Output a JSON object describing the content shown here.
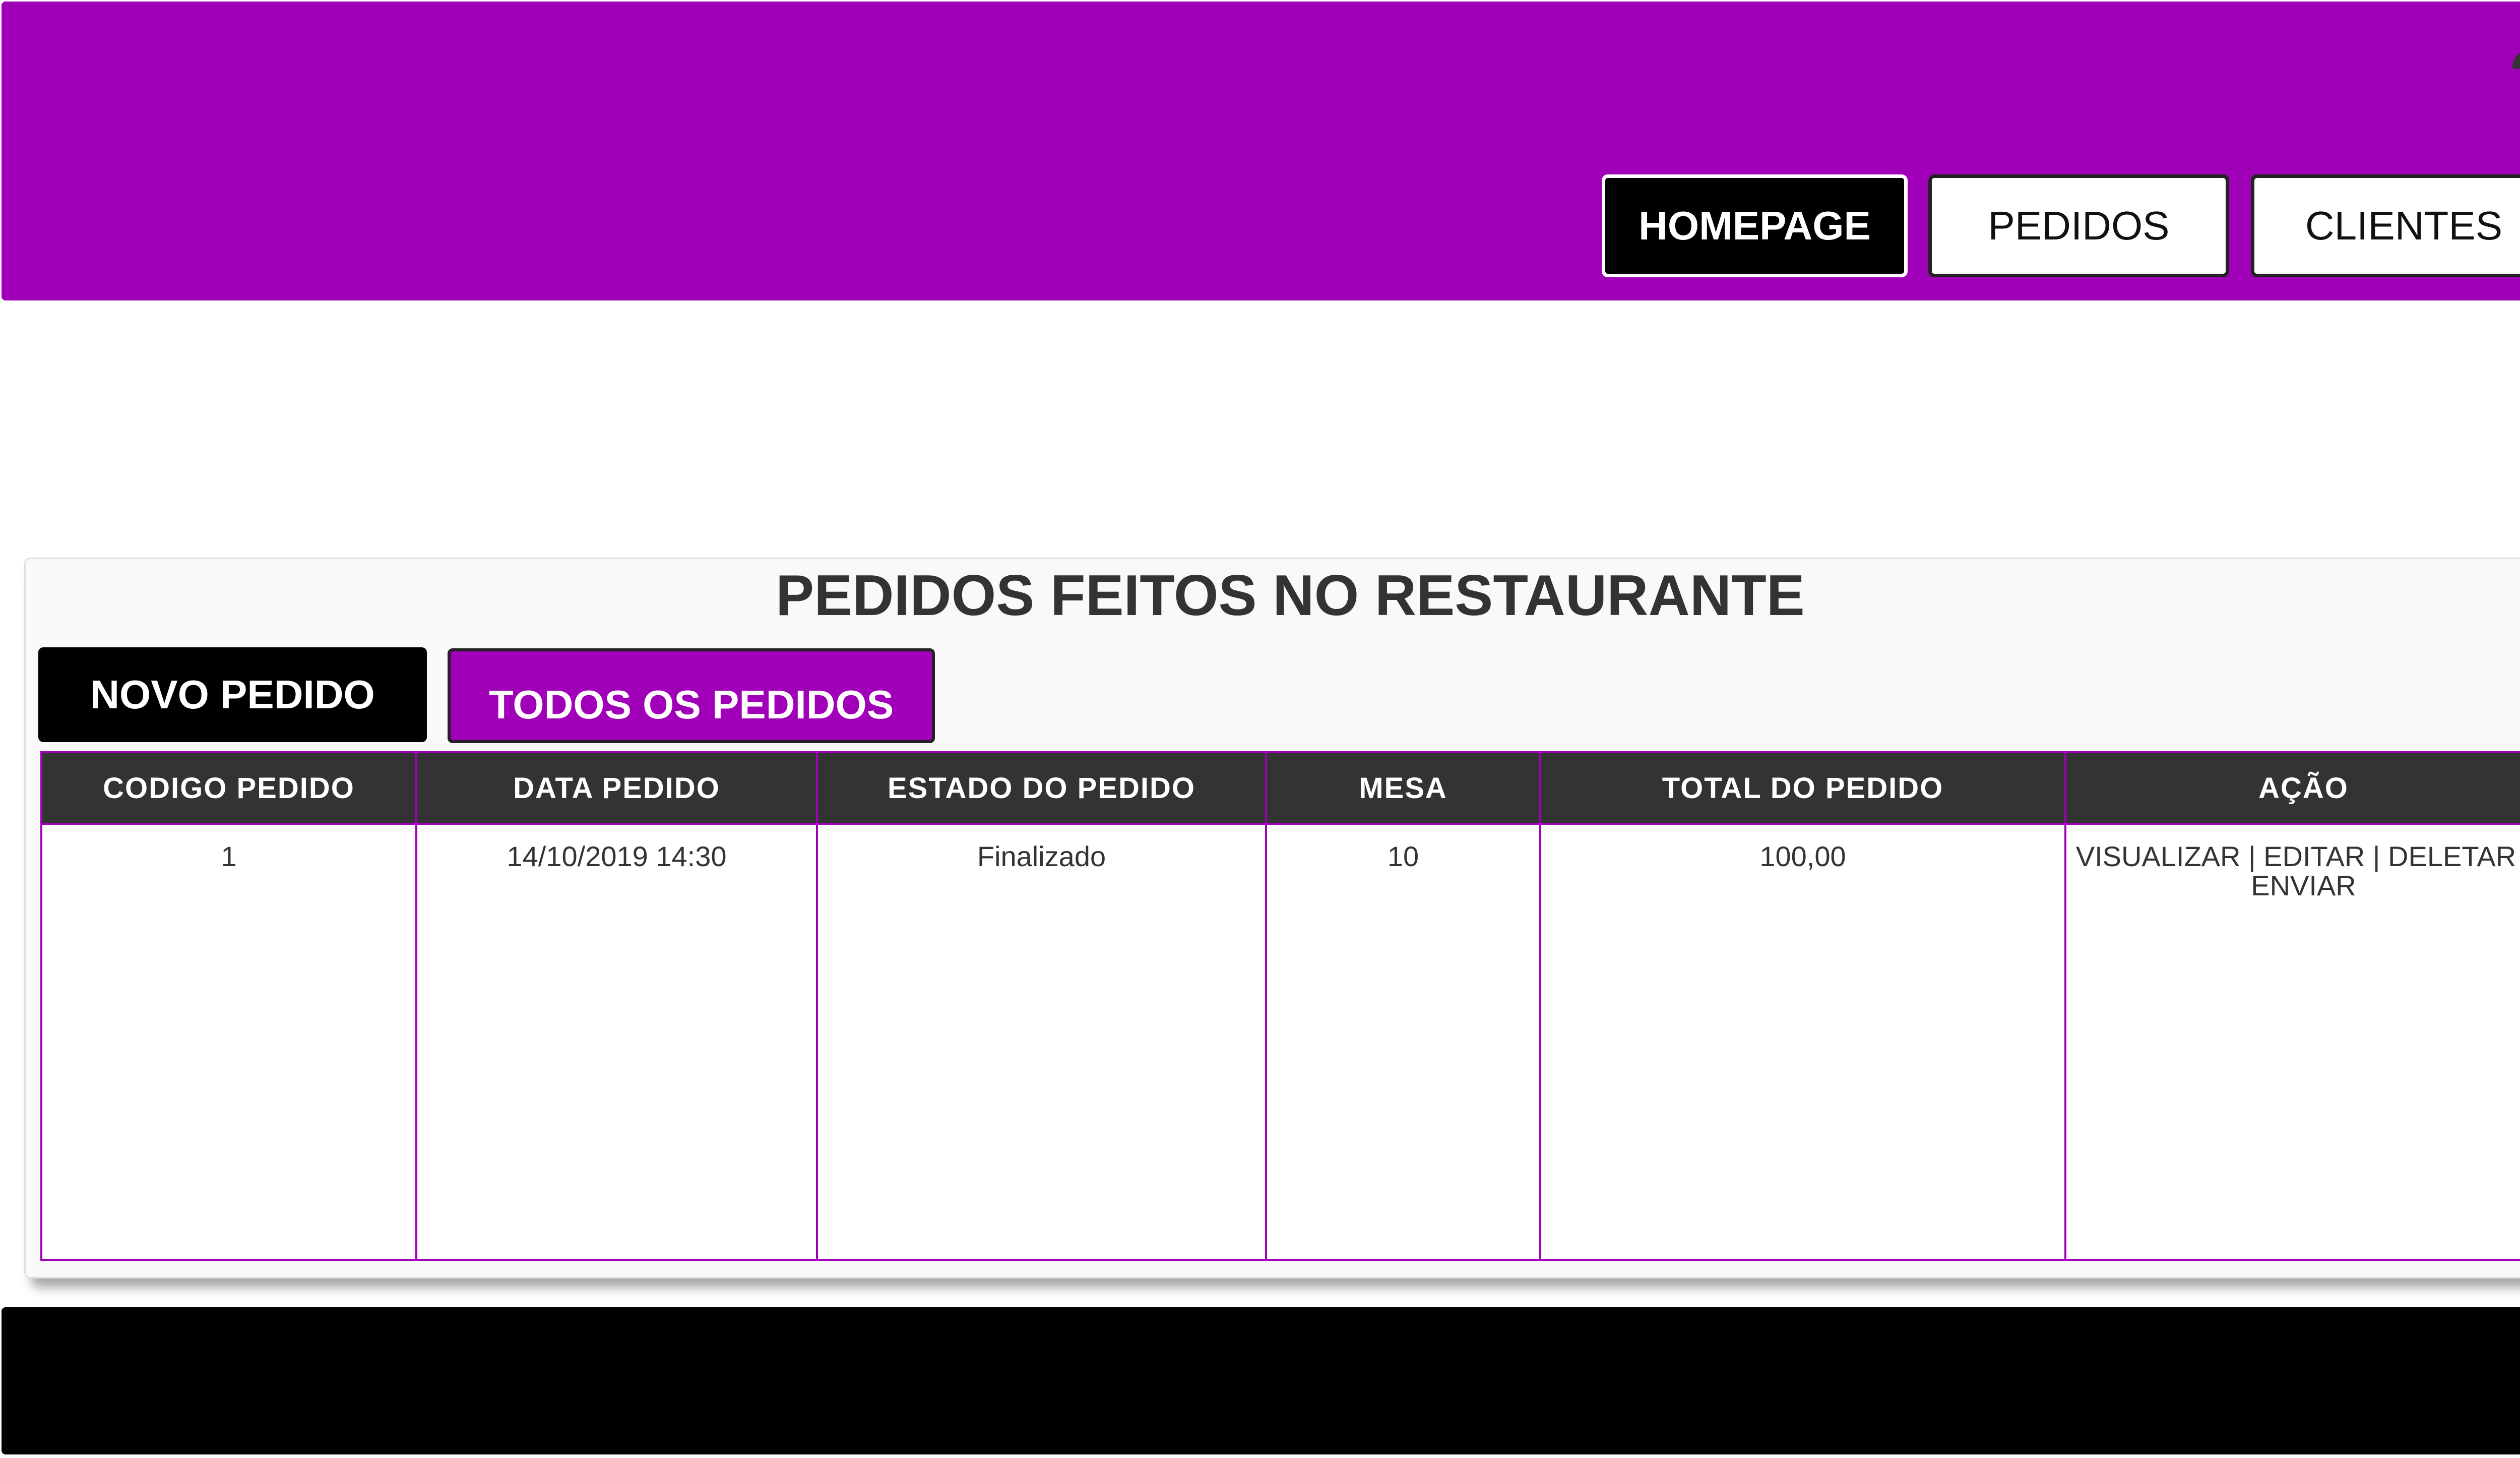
{
  "header": {
    "bg_color": "#a000b8",
    "user_icon": "user-icon",
    "nav": [
      {
        "label": "HOMEPAGE",
        "active": true
      },
      {
        "label": "PEDIDOS",
        "active": false
      },
      {
        "label": "CLIENTES",
        "active": false
      }
    ]
  },
  "main": {
    "title": "PEDIDOS FEITOS NO RESTAURANTE",
    "buttons": {
      "novo": "NOVO PEDIDO",
      "todos": "TODOS OS PEDIDOS"
    },
    "table": {
      "columns": [
        "CODIGO PEDIDO",
        "DATA PEDIDO",
        "ESTADO DO PEDIDO",
        "MESA",
        "TOTAL DO PEDIDO",
        "AÇÃO"
      ],
      "rows": [
        {
          "codigo": "1",
          "data": "14/10/2019 14:30",
          "estado": "Finalizado",
          "mesa": "10",
          "total": "100,00",
          "acoes": {
            "visualizar": "VISUALIZAR",
            "editar": "EDITAR",
            "deletar": "DELETAR",
            "enviar": "ENVIAR",
            "separator": "|"
          }
        }
      ]
    }
  },
  "colors": {
    "accent": "#a000b8",
    "dark": "#333333",
    "black": "#000000",
    "white": "#ffffff"
  }
}
